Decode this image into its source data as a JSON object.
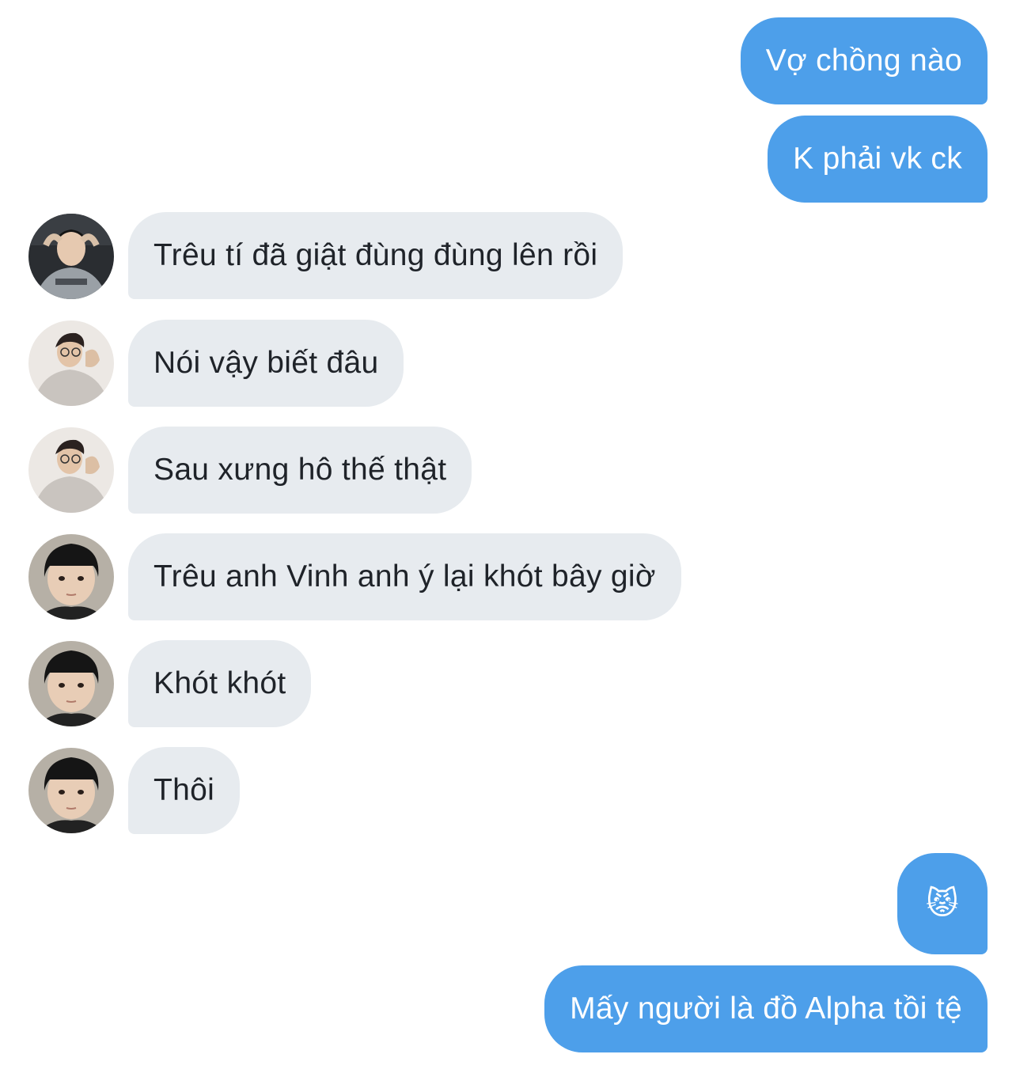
{
  "messages": [
    {
      "from": "me",
      "text": "Vợ chồng nào"
    },
    {
      "from": "me",
      "text": "K phải vk ck"
    },
    {
      "from": "user1",
      "text": "Trêu tí đã giật đùng đùng lên rồi"
    },
    {
      "from": "user2",
      "text": "Nói vậy biết đâu"
    },
    {
      "from": "user2",
      "text": "Sau xưng hô thế thật"
    },
    {
      "from": "user3",
      "text": "Trêu anh Vinh anh ý lại khót bây giờ"
    },
    {
      "from": "user3",
      "text": "Khót khót"
    },
    {
      "from": "user3",
      "text": "Thôi"
    },
    {
      "from": "me",
      "text": "😾"
    },
    {
      "from": "me",
      "text": "Mấy người là đồ Alpha tồi tệ"
    }
  ],
  "colors": {
    "outgoing_bubble": "#4d9fea",
    "incoming_bubble": "#e7ebef",
    "incoming_text": "#1f2329",
    "outgoing_text": "#ffffff"
  }
}
